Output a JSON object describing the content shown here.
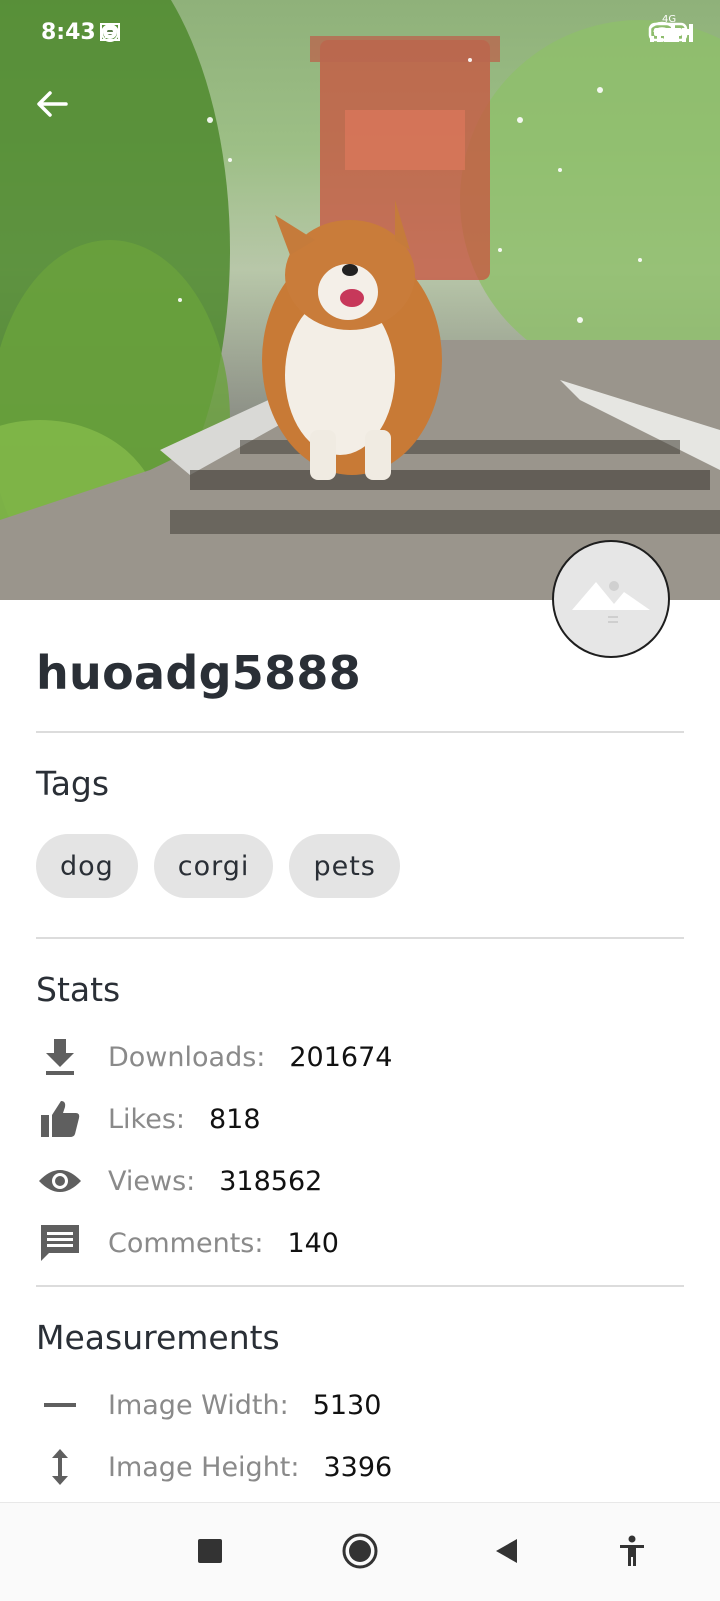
{
  "status_bar": {
    "time": "8:43",
    "left_icons": [
      "alarm-icon",
      "gear-icon",
      "news-icon"
    ],
    "right_icons": [
      "wifi-icon",
      "signal-4g-icon",
      "signal-icon",
      "battery-icon"
    ],
    "network_label": "4G"
  },
  "header": {
    "back_icon": "arrow-left-icon"
  },
  "profile": {
    "username": "huoadg5888",
    "avatar_icon": "mountain-placeholder-icon"
  },
  "tags": {
    "title": "Tags",
    "items": [
      "dog",
      "corgi",
      "pets"
    ]
  },
  "stats": {
    "title": "Stats",
    "items": [
      {
        "icon": "download-icon",
        "label": "Downloads:",
        "value": "201674"
      },
      {
        "icon": "thumbs-up-icon",
        "label": "Likes:",
        "value": "818"
      },
      {
        "icon": "eye-icon",
        "label": "Views:",
        "value": "318562"
      },
      {
        "icon": "comment-icon",
        "label": "Comments:",
        "value": "140"
      }
    ]
  },
  "measurements": {
    "title": "Measurements",
    "items": [
      {
        "icon": "width-icon",
        "label": "Image Width:",
        "value": "5130"
      },
      {
        "icon": "height-icon",
        "label": "Image Height:",
        "value": "3396"
      }
    ]
  },
  "nav_bar": {
    "buttons": [
      "recents-square-icon",
      "home-circle-icon",
      "back-triangle-icon",
      "accessibility-icon"
    ]
  }
}
